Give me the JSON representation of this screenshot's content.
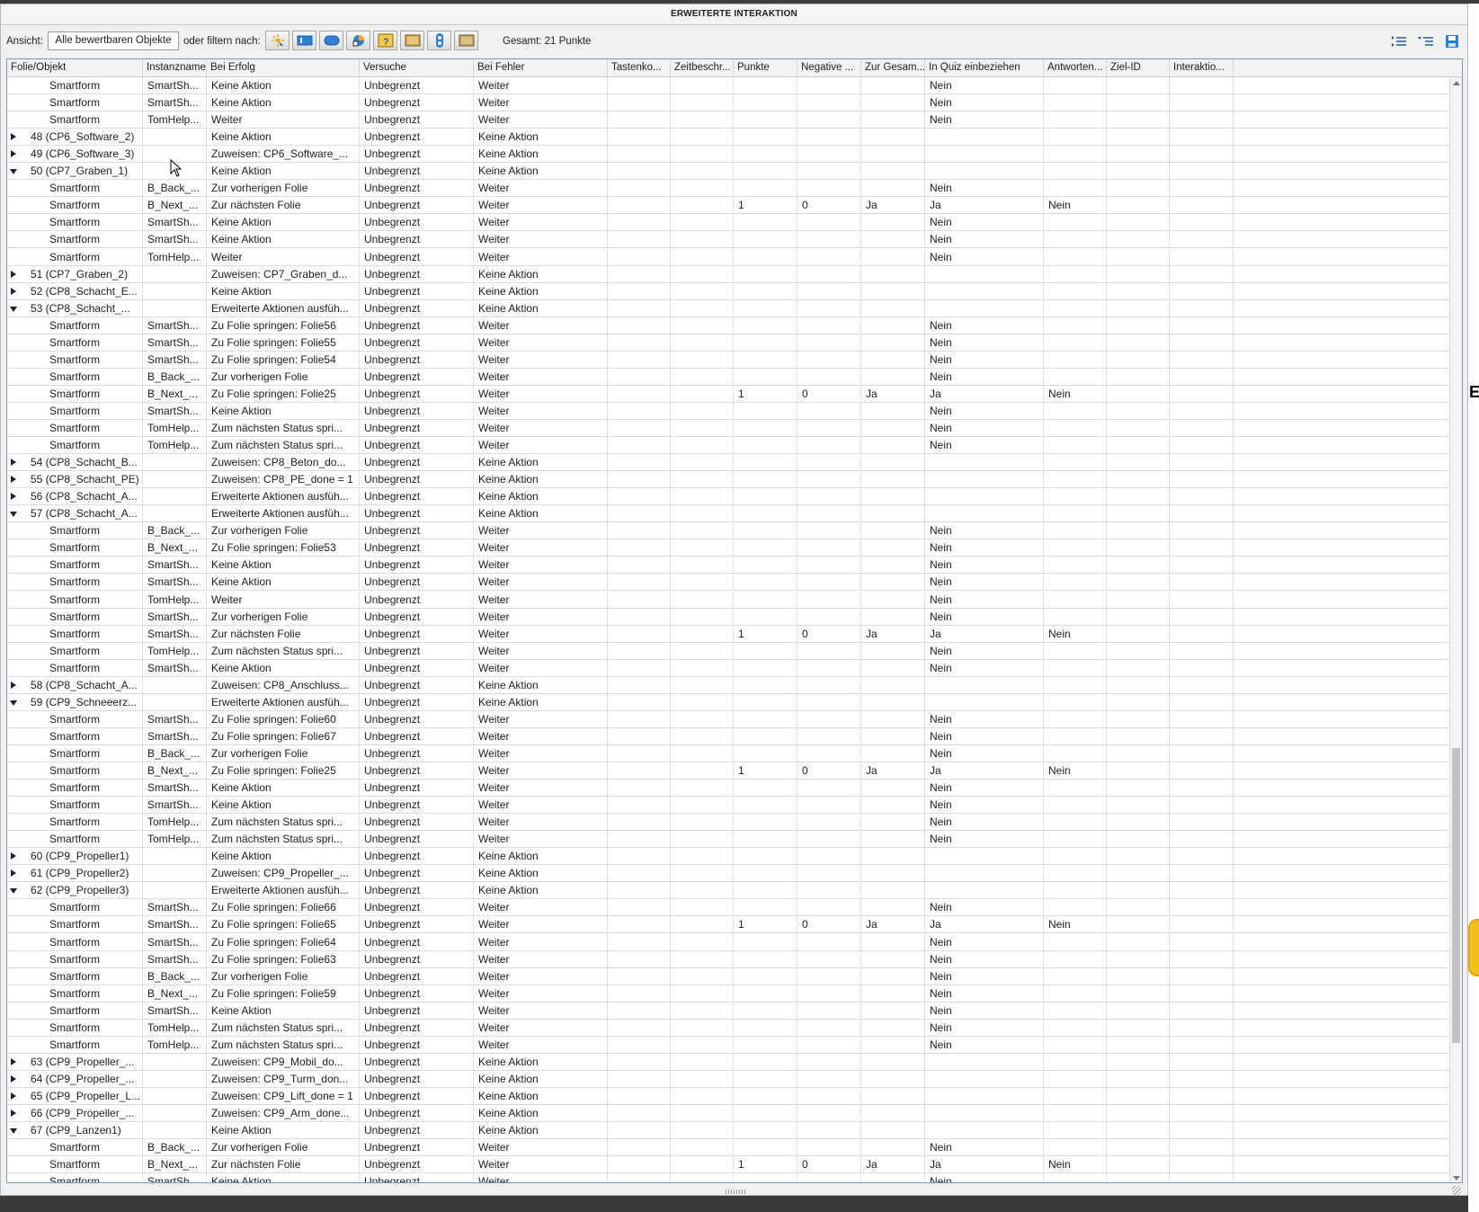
{
  "window": {
    "title": "ERWEITERTE INTERAKTION"
  },
  "toolbar": {
    "view_label": "Ansicht:",
    "view_value": "Alle bewertbaren Objekte",
    "filter_label": "oder filtern nach:",
    "filter_icons": [
      "click-box-icon",
      "text-entry-box-icon",
      "button-icon",
      "drag-drop-icon",
      "question-slide-icon",
      "image-icon",
      "widget-icon",
      "smartshape-icon"
    ],
    "total": "Gesamt: 21 Punkte",
    "right_icons": [
      "collapse-all-icon",
      "expand-all-icon",
      "save-icon"
    ]
  },
  "columns": [
    "Folie/Objekt",
    "Instanzname",
    "Bei Erfolg",
    "Versuche",
    "Bei Fehler",
    "Tastenko...",
    "Zeitbeschr...",
    "Punkte",
    "Negative ...",
    "Zur Gesam...",
    "In Quiz einbeziehen",
    "Antworten...",
    "Ziel-ID",
    "Interaktio..."
  ],
  "rows": [
    {
      "kind": "child",
      "obj": "Smartform",
      "inst": "SmartSh...",
      "succ": "Keine Aktion",
      "tries": "Unbegrenzt",
      "fail": "Weiter",
      "pts": "",
      "neg": "",
      "total": "",
      "quiz": "Nein",
      "ans": ""
    },
    {
      "kind": "child",
      "obj": "Smartform",
      "inst": "SmartSh...",
      "succ": "Keine Aktion",
      "tries": "Unbegrenzt",
      "fail": "Weiter",
      "pts": "",
      "neg": "",
      "total": "",
      "quiz": "Nein",
      "ans": ""
    },
    {
      "kind": "child",
      "obj": "Smartform",
      "inst": "TomHelp...",
      "succ": "Weiter",
      "tries": "Unbegrenzt",
      "fail": "Weiter",
      "pts": "",
      "neg": "",
      "total": "",
      "quiz": "Nein",
      "ans": ""
    },
    {
      "kind": "slide",
      "state": "collapsed",
      "obj": "48 (CP6_Software_2)",
      "inst": "",
      "succ": "Keine Aktion",
      "tries": "Unbegrenzt",
      "fail": "Keine Aktion",
      "pts": "",
      "neg": "",
      "total": "",
      "quiz": "",
      "ans": ""
    },
    {
      "kind": "slide",
      "state": "collapsed",
      "obj": "49 (CP6_Software_3)",
      "inst": "",
      "succ": "Zuweisen: CP6_Software_...",
      "tries": "Unbegrenzt",
      "fail": "Keine Aktion",
      "pts": "",
      "neg": "",
      "total": "",
      "quiz": "",
      "ans": ""
    },
    {
      "kind": "slide",
      "state": "expanded",
      "obj": "50 (CP7_Graben_1)",
      "inst": "",
      "succ": "Keine Aktion",
      "tries": "Unbegrenzt",
      "fail": "Keine Aktion",
      "pts": "",
      "neg": "",
      "total": "",
      "quiz": "",
      "ans": ""
    },
    {
      "kind": "child",
      "obj": "Smartform",
      "inst": "B_Back_...",
      "succ": "Zur vorherigen Folie",
      "tries": "Unbegrenzt",
      "fail": "Weiter",
      "pts": "",
      "neg": "",
      "total": "",
      "quiz": "Nein",
      "ans": ""
    },
    {
      "kind": "child",
      "obj": "Smartform",
      "inst": "B_Next_...",
      "succ": "Zur nächsten Folie",
      "tries": "Unbegrenzt",
      "fail": "Weiter",
      "pts": "1",
      "neg": "0",
      "total": "Ja",
      "quiz": "Ja",
      "ans": "Nein"
    },
    {
      "kind": "child",
      "obj": "Smartform",
      "inst": "SmartSh...",
      "succ": "Keine Aktion",
      "tries": "Unbegrenzt",
      "fail": "Weiter",
      "pts": "",
      "neg": "",
      "total": "",
      "quiz": "Nein",
      "ans": ""
    },
    {
      "kind": "child",
      "obj": "Smartform",
      "inst": "SmartSh...",
      "succ": "Keine Aktion",
      "tries": "Unbegrenzt",
      "fail": "Weiter",
      "pts": "",
      "neg": "",
      "total": "",
      "quiz": "Nein",
      "ans": ""
    },
    {
      "kind": "child",
      "obj": "Smartform",
      "inst": "TomHelp...",
      "succ": "Weiter",
      "tries": "Unbegrenzt",
      "fail": "Weiter",
      "pts": "",
      "neg": "",
      "total": "",
      "quiz": "Nein",
      "ans": ""
    },
    {
      "kind": "slide",
      "state": "collapsed",
      "obj": "51 (CP7_Graben_2)",
      "inst": "",
      "succ": "Zuweisen: CP7_Graben_d...",
      "tries": "Unbegrenzt",
      "fail": "Keine Aktion",
      "pts": "",
      "neg": "",
      "total": "",
      "quiz": "",
      "ans": ""
    },
    {
      "kind": "slide",
      "state": "collapsed",
      "obj": "52 (CP8_Schacht_E...",
      "inst": "",
      "succ": "Keine Aktion",
      "tries": "Unbegrenzt",
      "fail": "Keine Aktion",
      "pts": "",
      "neg": "",
      "total": "",
      "quiz": "",
      "ans": ""
    },
    {
      "kind": "slide",
      "state": "expanded",
      "obj": "53 (CP8_Schacht_...",
      "inst": "",
      "succ": "Erweiterte Aktionen ausfüh...",
      "tries": "Unbegrenzt",
      "fail": "Keine Aktion",
      "pts": "",
      "neg": "",
      "total": "",
      "quiz": "",
      "ans": ""
    },
    {
      "kind": "child",
      "obj": "Smartform",
      "inst": "SmartSh...",
      "succ": "Zu Folie springen: Folie56",
      "tries": "Unbegrenzt",
      "fail": "Weiter",
      "pts": "",
      "neg": "",
      "total": "",
      "quiz": "Nein",
      "ans": ""
    },
    {
      "kind": "child",
      "obj": "Smartform",
      "inst": "SmartSh...",
      "succ": "Zu Folie springen: Folie55",
      "tries": "Unbegrenzt",
      "fail": "Weiter",
      "pts": "",
      "neg": "",
      "total": "",
      "quiz": "Nein",
      "ans": ""
    },
    {
      "kind": "child",
      "obj": "Smartform",
      "inst": "SmartSh...",
      "succ": "Zu Folie springen: Folie54",
      "tries": "Unbegrenzt",
      "fail": "Weiter",
      "pts": "",
      "neg": "",
      "total": "",
      "quiz": "Nein",
      "ans": ""
    },
    {
      "kind": "child",
      "obj": "Smartform",
      "inst": "B_Back_...",
      "succ": "Zur vorherigen Folie",
      "tries": "Unbegrenzt",
      "fail": "Weiter",
      "pts": "",
      "neg": "",
      "total": "",
      "quiz": "Nein",
      "ans": ""
    },
    {
      "kind": "child",
      "obj": "Smartform",
      "inst": "B_Next_...",
      "succ": "Zu Folie springen: Folie25",
      "tries": "Unbegrenzt",
      "fail": "Weiter",
      "pts": "1",
      "neg": "0",
      "total": "Ja",
      "quiz": "Ja",
      "ans": "Nein"
    },
    {
      "kind": "child",
      "obj": "Smartform",
      "inst": "SmartSh...",
      "succ": "Keine Aktion",
      "tries": "Unbegrenzt",
      "fail": "Weiter",
      "pts": "",
      "neg": "",
      "total": "",
      "quiz": "Nein",
      "ans": ""
    },
    {
      "kind": "child",
      "obj": "Smartform",
      "inst": "TomHelp...",
      "succ": "Zum nächsten Status spri...",
      "tries": "Unbegrenzt",
      "fail": "Weiter",
      "pts": "",
      "neg": "",
      "total": "",
      "quiz": "Nein",
      "ans": ""
    },
    {
      "kind": "child",
      "obj": "Smartform",
      "inst": "TomHelp...",
      "succ": "Zum nächsten Status spri...",
      "tries": "Unbegrenzt",
      "fail": "Weiter",
      "pts": "",
      "neg": "",
      "total": "",
      "quiz": "Nein",
      "ans": ""
    },
    {
      "kind": "slide",
      "state": "collapsed",
      "obj": "54 (CP8_Schacht_B...",
      "inst": "",
      "succ": "Zuweisen: CP8_Beton_do...",
      "tries": "Unbegrenzt",
      "fail": "Keine Aktion",
      "pts": "",
      "neg": "",
      "total": "",
      "quiz": "",
      "ans": ""
    },
    {
      "kind": "slide",
      "state": "collapsed",
      "obj": "55 (CP8_Schacht_PE)",
      "inst": "",
      "succ": "Zuweisen: CP8_PE_done = 1",
      "tries": "Unbegrenzt",
      "fail": "Keine Aktion",
      "pts": "",
      "neg": "",
      "total": "",
      "quiz": "",
      "ans": ""
    },
    {
      "kind": "slide",
      "state": "collapsed",
      "obj": "56 (CP8_Schacht_A...",
      "inst": "",
      "succ": "Erweiterte Aktionen ausfüh...",
      "tries": "Unbegrenzt",
      "fail": "Keine Aktion",
      "pts": "",
      "neg": "",
      "total": "",
      "quiz": "",
      "ans": ""
    },
    {
      "kind": "slide",
      "state": "expanded",
      "obj": "57 (CP8_Schacht_A...",
      "inst": "",
      "succ": "Erweiterte Aktionen ausfüh...",
      "tries": "Unbegrenzt",
      "fail": "Keine Aktion",
      "pts": "",
      "neg": "",
      "total": "",
      "quiz": "",
      "ans": ""
    },
    {
      "kind": "child",
      "obj": "Smartform",
      "inst": "B_Back_...",
      "succ": "Zur vorherigen Folie",
      "tries": "Unbegrenzt",
      "fail": "Weiter",
      "pts": "",
      "neg": "",
      "total": "",
      "quiz": "Nein",
      "ans": ""
    },
    {
      "kind": "child",
      "obj": "Smartform",
      "inst": "B_Next_...",
      "succ": "Zu Folie springen: Folie53",
      "tries": "Unbegrenzt",
      "fail": "Weiter",
      "pts": "",
      "neg": "",
      "total": "",
      "quiz": "Nein",
      "ans": ""
    },
    {
      "kind": "child",
      "obj": "Smartform",
      "inst": "SmartSh...",
      "succ": "Keine Aktion",
      "tries": "Unbegrenzt",
      "fail": "Weiter",
      "pts": "",
      "neg": "",
      "total": "",
      "quiz": "Nein",
      "ans": ""
    },
    {
      "kind": "child",
      "obj": "Smartform",
      "inst": "SmartSh...",
      "succ": "Keine Aktion",
      "tries": "Unbegrenzt",
      "fail": "Weiter",
      "pts": "",
      "neg": "",
      "total": "",
      "quiz": "Nein",
      "ans": ""
    },
    {
      "kind": "child",
      "obj": "Smartform",
      "inst": "TomHelp...",
      "succ": "Weiter",
      "tries": "Unbegrenzt",
      "fail": "Weiter",
      "pts": "",
      "neg": "",
      "total": "",
      "quiz": "Nein",
      "ans": ""
    },
    {
      "kind": "child",
      "obj": "Smartform",
      "inst": "SmartSh...",
      "succ": "Zur vorherigen Folie",
      "tries": "Unbegrenzt",
      "fail": "Weiter",
      "pts": "",
      "neg": "",
      "total": "",
      "quiz": "Nein",
      "ans": ""
    },
    {
      "kind": "child",
      "obj": "Smartform",
      "inst": "SmartSh...",
      "succ": "Zur nächsten Folie",
      "tries": "Unbegrenzt",
      "fail": "Weiter",
      "pts": "1",
      "neg": "0",
      "total": "Ja",
      "quiz": "Ja",
      "ans": "Nein"
    },
    {
      "kind": "child",
      "obj": "Smartform",
      "inst": "TomHelp...",
      "succ": "Zum nächsten Status spri...",
      "tries": "Unbegrenzt",
      "fail": "Weiter",
      "pts": "",
      "neg": "",
      "total": "",
      "quiz": "Nein",
      "ans": ""
    },
    {
      "kind": "child",
      "obj": "Smartform",
      "inst": "SmartSh...",
      "succ": "Keine Aktion",
      "tries": "Unbegrenzt",
      "fail": "Weiter",
      "pts": "",
      "neg": "",
      "total": "",
      "quiz": "Nein",
      "ans": ""
    },
    {
      "kind": "slide",
      "state": "collapsed",
      "obj": "58 (CP8_Schacht_A...",
      "inst": "",
      "succ": "Zuweisen: CP8_Anschluss...",
      "tries": "Unbegrenzt",
      "fail": "Keine Aktion",
      "pts": "",
      "neg": "",
      "total": "",
      "quiz": "",
      "ans": ""
    },
    {
      "kind": "slide",
      "state": "expanded",
      "obj": "59 (CP9_Schneeerz...",
      "inst": "",
      "succ": "Erweiterte Aktionen ausfüh...",
      "tries": "Unbegrenzt",
      "fail": "Keine Aktion",
      "pts": "",
      "neg": "",
      "total": "",
      "quiz": "",
      "ans": ""
    },
    {
      "kind": "child",
      "obj": "Smartform",
      "inst": "SmartSh...",
      "succ": "Zu Folie springen: Folie60",
      "tries": "Unbegrenzt",
      "fail": "Weiter",
      "pts": "",
      "neg": "",
      "total": "",
      "quiz": "Nein",
      "ans": ""
    },
    {
      "kind": "child",
      "obj": "Smartform",
      "inst": "SmartSh...",
      "succ": "Zu Folie springen: Folie67",
      "tries": "Unbegrenzt",
      "fail": "Weiter",
      "pts": "",
      "neg": "",
      "total": "",
      "quiz": "Nein",
      "ans": ""
    },
    {
      "kind": "child",
      "obj": "Smartform",
      "inst": "B_Back_...",
      "succ": "Zur vorherigen Folie",
      "tries": "Unbegrenzt",
      "fail": "Weiter",
      "pts": "",
      "neg": "",
      "total": "",
      "quiz": "Nein",
      "ans": ""
    },
    {
      "kind": "child",
      "obj": "Smartform",
      "inst": "B_Next_...",
      "succ": "Zu Folie springen: Folie25",
      "tries": "Unbegrenzt",
      "fail": "Weiter",
      "pts": "1",
      "neg": "0",
      "total": "Ja",
      "quiz": "Ja",
      "ans": "Nein"
    },
    {
      "kind": "child",
      "obj": "Smartform",
      "inst": "SmartSh...",
      "succ": "Keine Aktion",
      "tries": "Unbegrenzt",
      "fail": "Weiter",
      "pts": "",
      "neg": "",
      "total": "",
      "quiz": "Nein",
      "ans": ""
    },
    {
      "kind": "child",
      "obj": "Smartform",
      "inst": "SmartSh...",
      "succ": "Keine Aktion",
      "tries": "Unbegrenzt",
      "fail": "Weiter",
      "pts": "",
      "neg": "",
      "total": "",
      "quiz": "Nein",
      "ans": ""
    },
    {
      "kind": "child",
      "obj": "Smartform",
      "inst": "TomHelp...",
      "succ": "Zum nächsten Status spri...",
      "tries": "Unbegrenzt",
      "fail": "Weiter",
      "pts": "",
      "neg": "",
      "total": "",
      "quiz": "Nein",
      "ans": ""
    },
    {
      "kind": "child",
      "obj": "Smartform",
      "inst": "TomHelp...",
      "succ": "Zum nächsten Status spri...",
      "tries": "Unbegrenzt",
      "fail": "Weiter",
      "pts": "",
      "neg": "",
      "total": "",
      "quiz": "Nein",
      "ans": ""
    },
    {
      "kind": "slide",
      "state": "collapsed",
      "obj": "60 (CP9_Propeller1)",
      "inst": "",
      "succ": "Keine Aktion",
      "tries": "Unbegrenzt",
      "fail": "Keine Aktion",
      "pts": "",
      "neg": "",
      "total": "",
      "quiz": "",
      "ans": ""
    },
    {
      "kind": "slide",
      "state": "collapsed",
      "obj": "61 (CP9_Propeller2)",
      "inst": "",
      "succ": "Zuweisen: CP9_Propeller_...",
      "tries": "Unbegrenzt",
      "fail": "Keine Aktion",
      "pts": "",
      "neg": "",
      "total": "",
      "quiz": "",
      "ans": ""
    },
    {
      "kind": "slide",
      "state": "expanded",
      "obj": "62 (CP9_Propeller3)",
      "inst": "",
      "succ": "Erweiterte Aktionen ausfüh...",
      "tries": "Unbegrenzt",
      "fail": "Keine Aktion",
      "pts": "",
      "neg": "",
      "total": "",
      "quiz": "",
      "ans": ""
    },
    {
      "kind": "child",
      "obj": "Smartform",
      "inst": "SmartSh...",
      "succ": "Zu Folie springen: Folie66",
      "tries": "Unbegrenzt",
      "fail": "Weiter",
      "pts": "",
      "neg": "",
      "total": "",
      "quiz": "Nein",
      "ans": ""
    },
    {
      "kind": "child",
      "obj": "Smartform",
      "inst": "SmartSh...",
      "succ": "Zu Folie springen: Folie65",
      "tries": "Unbegrenzt",
      "fail": "Weiter",
      "pts": "1",
      "neg": "0",
      "total": "Ja",
      "quiz": "Ja",
      "ans": "Nein"
    },
    {
      "kind": "child",
      "obj": "Smartform",
      "inst": "SmartSh...",
      "succ": "Zu Folie springen: Folie64",
      "tries": "Unbegrenzt",
      "fail": "Weiter",
      "pts": "",
      "neg": "",
      "total": "",
      "quiz": "Nein",
      "ans": ""
    },
    {
      "kind": "child",
      "obj": "Smartform",
      "inst": "SmartSh...",
      "succ": "Zu Folie springen: Folie63",
      "tries": "Unbegrenzt",
      "fail": "Weiter",
      "pts": "",
      "neg": "",
      "total": "",
      "quiz": "Nein",
      "ans": ""
    },
    {
      "kind": "child",
      "obj": "Smartform",
      "inst": "B_Back_...",
      "succ": "Zur vorherigen Folie",
      "tries": "Unbegrenzt",
      "fail": "Weiter",
      "pts": "",
      "neg": "",
      "total": "",
      "quiz": "Nein",
      "ans": ""
    },
    {
      "kind": "child",
      "obj": "Smartform",
      "inst": "B_Next_...",
      "succ": "Zu Folie springen: Folie59",
      "tries": "Unbegrenzt",
      "fail": "Weiter",
      "pts": "",
      "neg": "",
      "total": "",
      "quiz": "Nein",
      "ans": ""
    },
    {
      "kind": "child",
      "obj": "Smartform",
      "inst": "SmartSh...",
      "succ": "Keine Aktion",
      "tries": "Unbegrenzt",
      "fail": "Weiter",
      "pts": "",
      "neg": "",
      "total": "",
      "quiz": "Nein",
      "ans": ""
    },
    {
      "kind": "child",
      "obj": "Smartform",
      "inst": "TomHelp...",
      "succ": "Zum nächsten Status spri...",
      "tries": "Unbegrenzt",
      "fail": "Weiter",
      "pts": "",
      "neg": "",
      "total": "",
      "quiz": "Nein",
      "ans": ""
    },
    {
      "kind": "child",
      "obj": "Smartform",
      "inst": "TomHelp...",
      "succ": "Zum nächsten Status spri...",
      "tries": "Unbegrenzt",
      "fail": "Weiter",
      "pts": "",
      "neg": "",
      "total": "",
      "quiz": "Nein",
      "ans": ""
    },
    {
      "kind": "slide",
      "state": "collapsed",
      "obj": "63 (CP9_Propeller_...",
      "inst": "",
      "succ": "Zuweisen: CP9_Mobil_do...",
      "tries": "Unbegrenzt",
      "fail": "Keine Aktion",
      "pts": "",
      "neg": "",
      "total": "",
      "quiz": "",
      "ans": ""
    },
    {
      "kind": "slide",
      "state": "collapsed",
      "obj": "64 (CP9_Propeller_...",
      "inst": "",
      "succ": "Zuweisen: CP9_Turm_don...",
      "tries": "Unbegrenzt",
      "fail": "Keine Aktion",
      "pts": "",
      "neg": "",
      "total": "",
      "quiz": "",
      "ans": ""
    },
    {
      "kind": "slide",
      "state": "collapsed",
      "obj": "65 (CP9_Propeller_L...",
      "inst": "",
      "succ": "Zuweisen: CP9_Lift_done = 1",
      "tries": "Unbegrenzt",
      "fail": "Keine Aktion",
      "pts": "",
      "neg": "",
      "total": "",
      "quiz": "",
      "ans": ""
    },
    {
      "kind": "slide",
      "state": "collapsed",
      "obj": "66 (CP9_Propeller_...",
      "inst": "",
      "succ": "Zuweisen: CP9_Arm_done...",
      "tries": "Unbegrenzt",
      "fail": "Keine Aktion",
      "pts": "",
      "neg": "",
      "total": "",
      "quiz": "",
      "ans": ""
    },
    {
      "kind": "slide",
      "state": "expanded",
      "obj": "67 (CP9_Lanzen1)",
      "inst": "",
      "succ": "Keine Aktion",
      "tries": "Unbegrenzt",
      "fail": "Keine Aktion",
      "pts": "",
      "neg": "",
      "total": "",
      "quiz": "",
      "ans": ""
    },
    {
      "kind": "child",
      "obj": "Smartform",
      "inst": "B_Back_...",
      "succ": "Zur vorherigen Folie",
      "tries": "Unbegrenzt",
      "fail": "Weiter",
      "pts": "",
      "neg": "",
      "total": "",
      "quiz": "Nein",
      "ans": ""
    },
    {
      "kind": "child",
      "obj": "Smartform",
      "inst": "B_Next_...",
      "succ": "Zur nächsten Folie",
      "tries": "Unbegrenzt",
      "fail": "Weiter",
      "pts": "1",
      "neg": "0",
      "total": "Ja",
      "quiz": "Ja",
      "ans": "Nein"
    },
    {
      "kind": "child",
      "obj": "Smartform",
      "inst": "SmartSh...",
      "succ": "Keine Aktion",
      "tries": "Unbegrenzt",
      "fail": "Weiter",
      "pts": "",
      "neg": "",
      "total": "",
      "quiz": "Nein",
      "ans": ""
    }
  ],
  "colors": {
    "window_bg": "#f0f0f0",
    "grid_border": "#7d98b3",
    "accent_blue": "#2f7fd0",
    "accent_yellow": "#f3c01a"
  }
}
